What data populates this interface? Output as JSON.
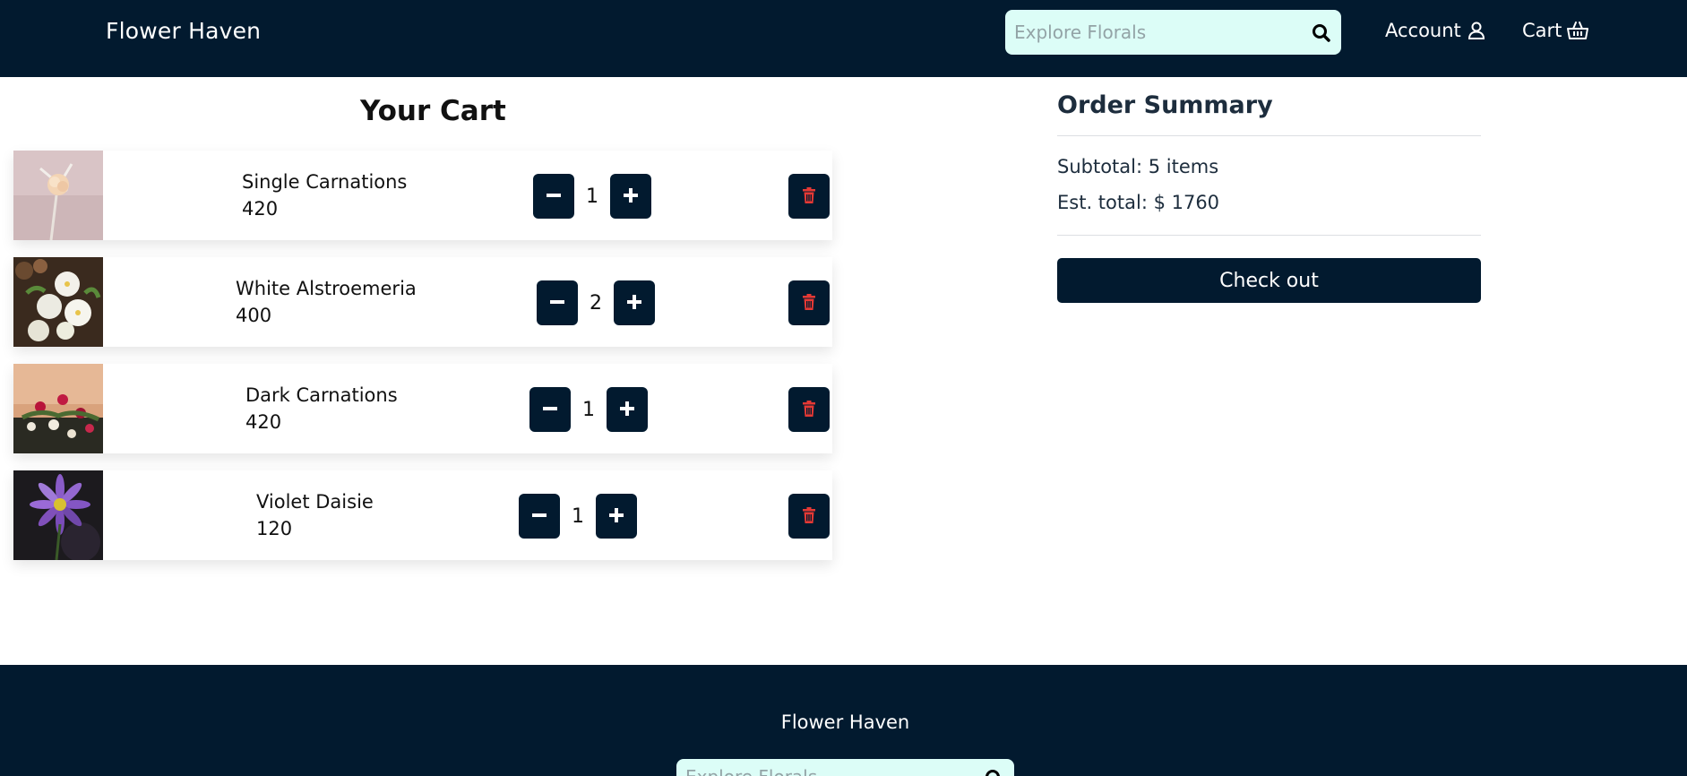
{
  "header": {
    "brand": "Flower Haven",
    "search_placeholder": "Explore Florals",
    "account_label": "Account",
    "cart_label": "Cart"
  },
  "cart": {
    "title": "Your Cart",
    "items": [
      {
        "name": "Single Carnations",
        "price": "420",
        "quantity": "1"
      },
      {
        "name": "White Alstroemeria",
        "price": "400",
        "quantity": "2"
      },
      {
        "name": "Dark Carnations",
        "price": "420",
        "quantity": "1"
      },
      {
        "name": "Violet Daisie",
        "price": "120",
        "quantity": "1"
      }
    ]
  },
  "summary": {
    "title": "Order Summary",
    "subtotal": "Subtotal: 5 items",
    "est_total": "Est. total: $ 1760",
    "checkout_label": "Check out"
  },
  "footer": {
    "brand": "Flower Haven",
    "search_placeholder": "Explore Florals"
  },
  "icons": {
    "search": "search-icon",
    "account": "user-icon",
    "cart": "basket-icon",
    "minus": "minus-icon",
    "plus": "plus-icon",
    "delete": "trash-icon"
  },
  "colors": {
    "navy": "#021a2f",
    "search_bg": "#dcfdf7",
    "trash_red": "#e53935"
  }
}
